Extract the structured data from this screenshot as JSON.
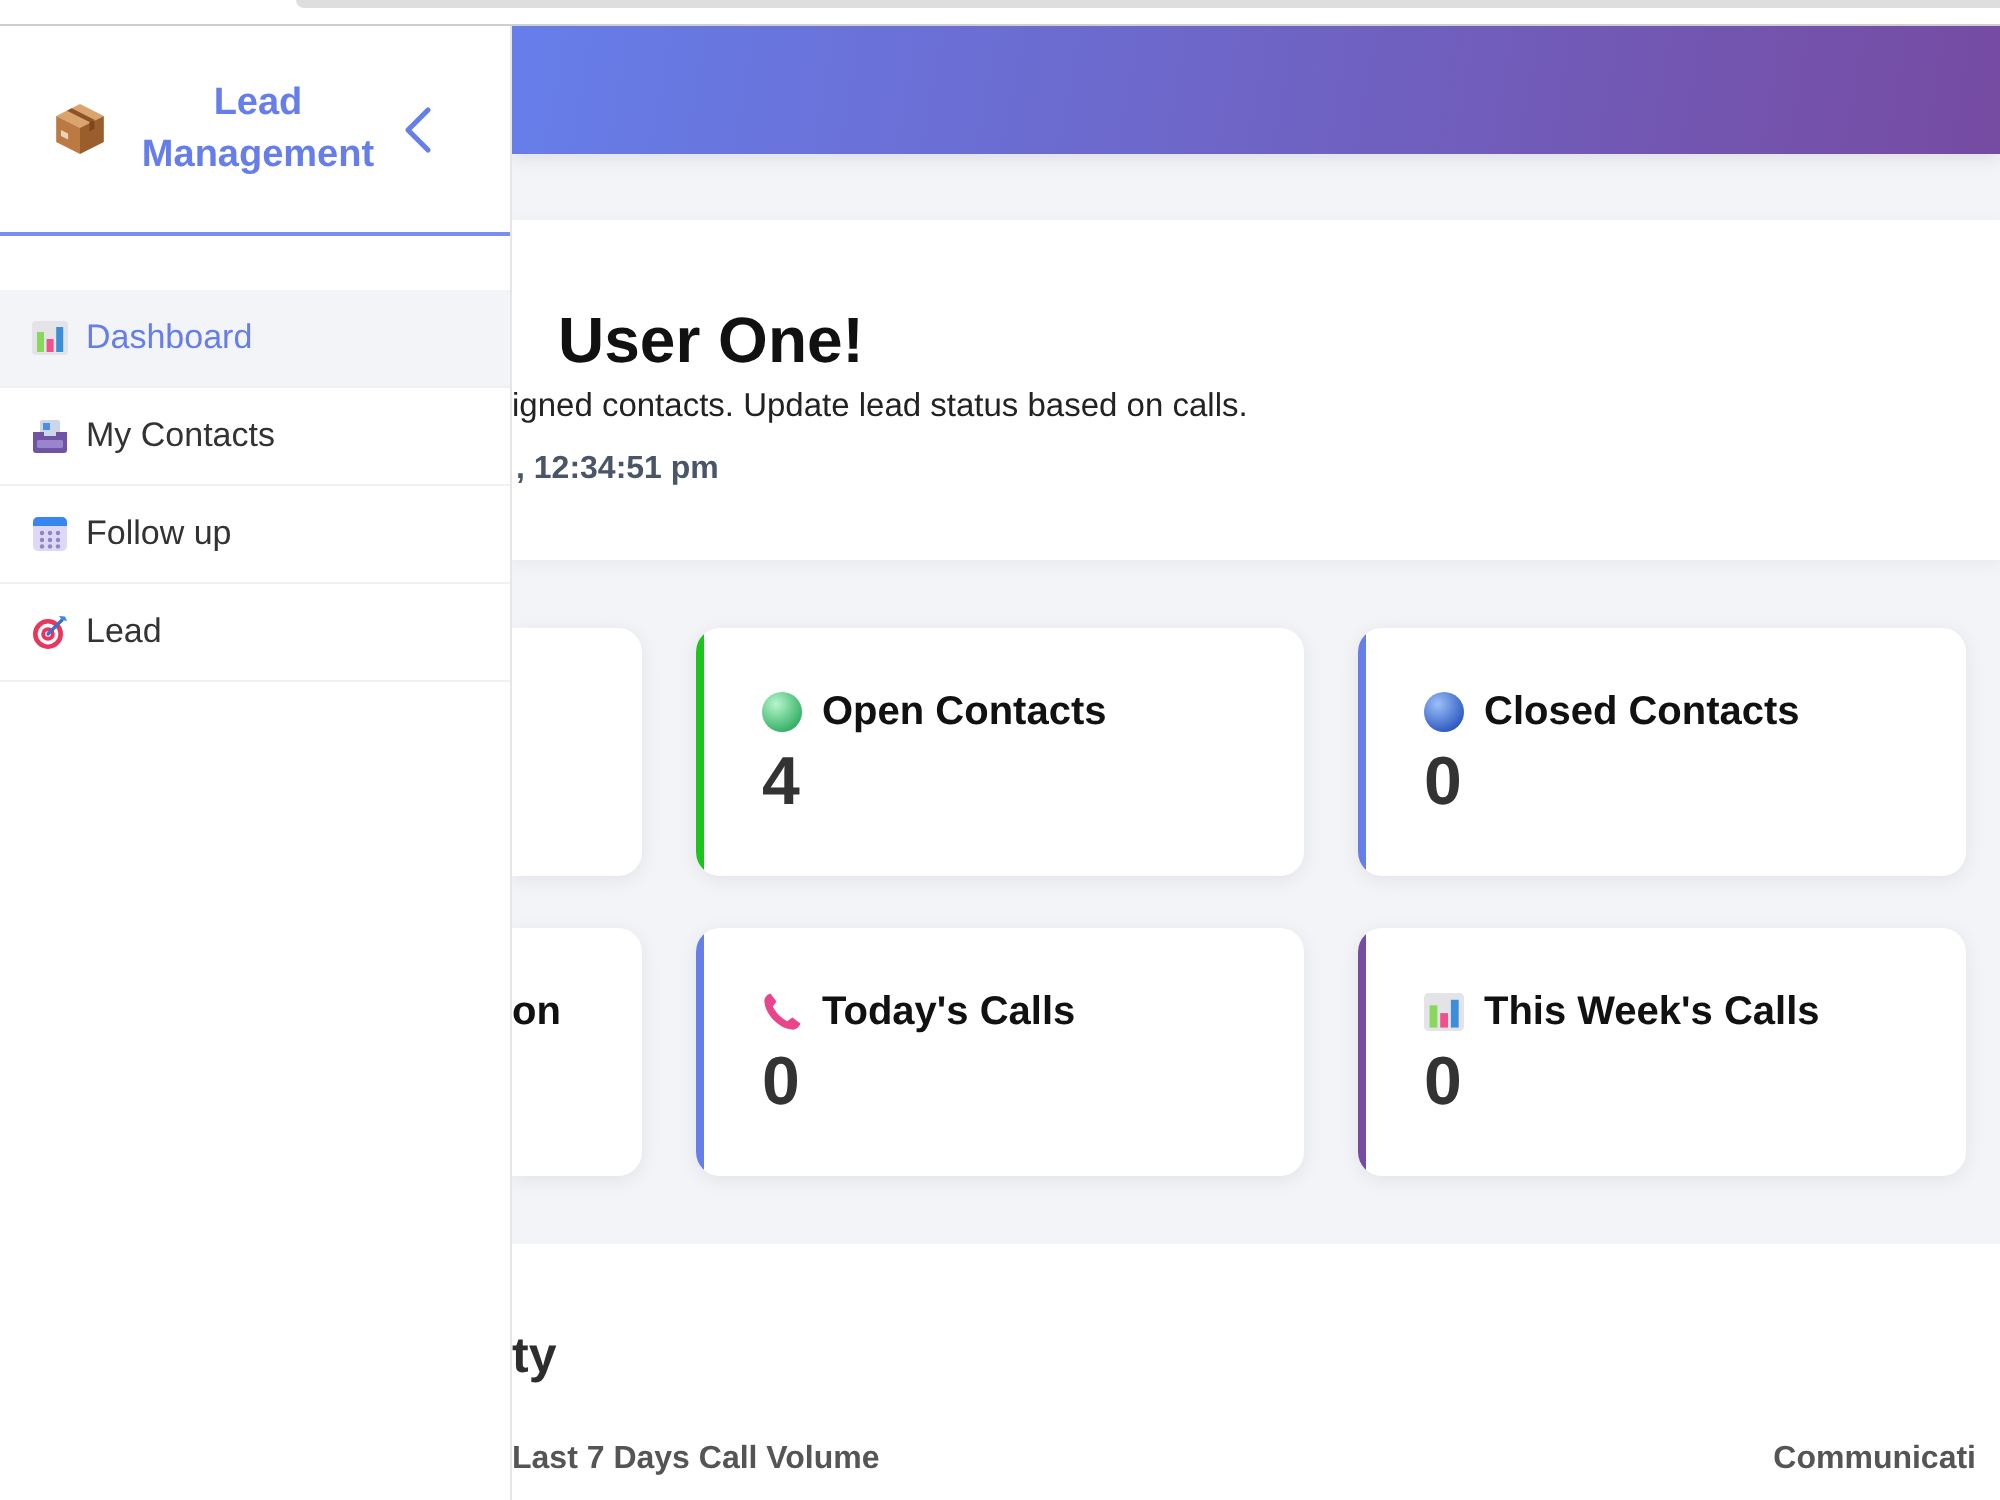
{
  "sidebar": {
    "title": "Lead Management",
    "items": [
      {
        "label": "Dashboard",
        "selected": true
      },
      {
        "label": "My Contacts",
        "selected": false
      },
      {
        "label": "Follow up",
        "selected": false
      },
      {
        "label": "Lead",
        "selected": false
      }
    ]
  },
  "welcome": {
    "title": "User One!",
    "subtitle": "igned contacts. Update lead status based on calls.",
    "timestamp": ", 12:34:51 pm"
  },
  "stat_rows": [
    {
      "cards": [
        {
          "label": "Open Contacts",
          "value": "4",
          "color": "#1ec31e"
        },
        {
          "label": "Closed Contacts",
          "value": "0",
          "color": "#667eea"
        }
      ]
    },
    {
      "cut_off_label": "on",
      "cards": [
        {
          "label": "Today's Calls",
          "value": "0",
          "color": "#667eea"
        },
        {
          "label": "This Week's Calls",
          "value": "0",
          "color": "#764ba2"
        }
      ]
    }
  ],
  "activity": {
    "title": "ty",
    "chart_titles": [
      "Last 7 Days Call Volume",
      "Communicati"
    ]
  }
}
